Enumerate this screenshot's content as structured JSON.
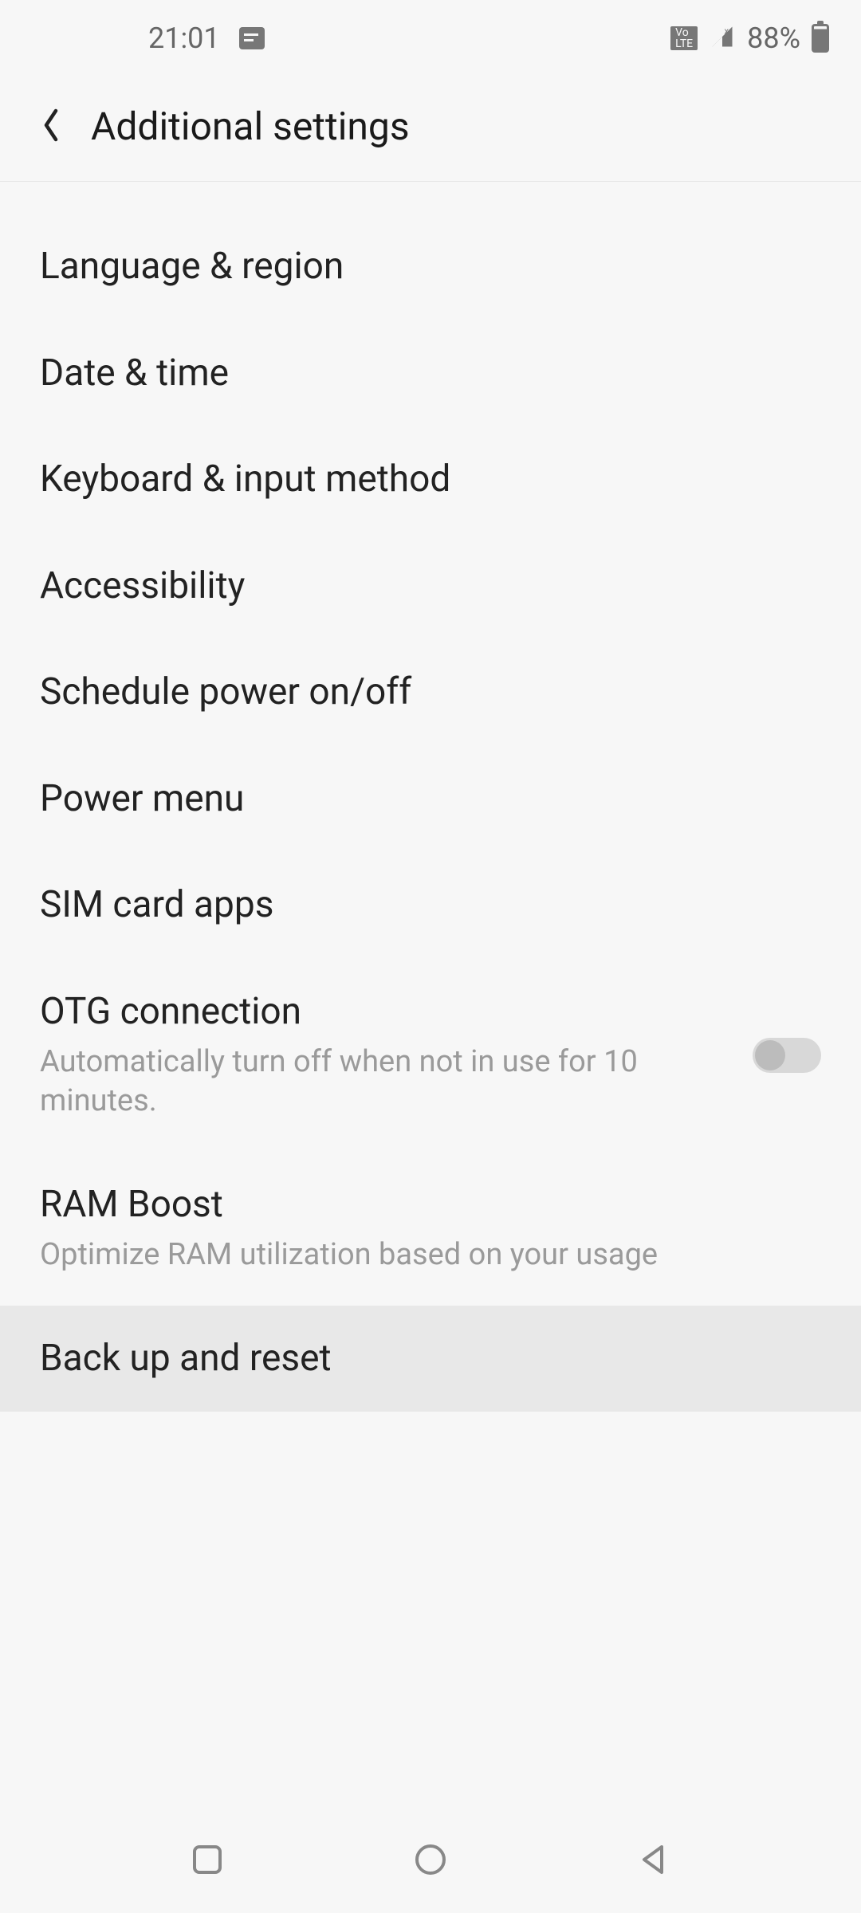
{
  "status": {
    "time": "21:01",
    "battery": "88%"
  },
  "header": {
    "title": "Additional settings"
  },
  "items": [
    {
      "title": "Language & region"
    },
    {
      "title": "Date & time"
    },
    {
      "title": "Keyboard & input method"
    },
    {
      "title": "Accessibility"
    },
    {
      "title": "Schedule power on/off"
    },
    {
      "title": "Power menu"
    },
    {
      "title": "SIM card apps"
    },
    {
      "title": "OTG connection",
      "sub": "Automatically turn off when not in use for 10 minutes."
    },
    {
      "title": "RAM Boost",
      "sub": "Optimize RAM utilization based on your usage"
    },
    {
      "title": "Back up and reset"
    }
  ]
}
